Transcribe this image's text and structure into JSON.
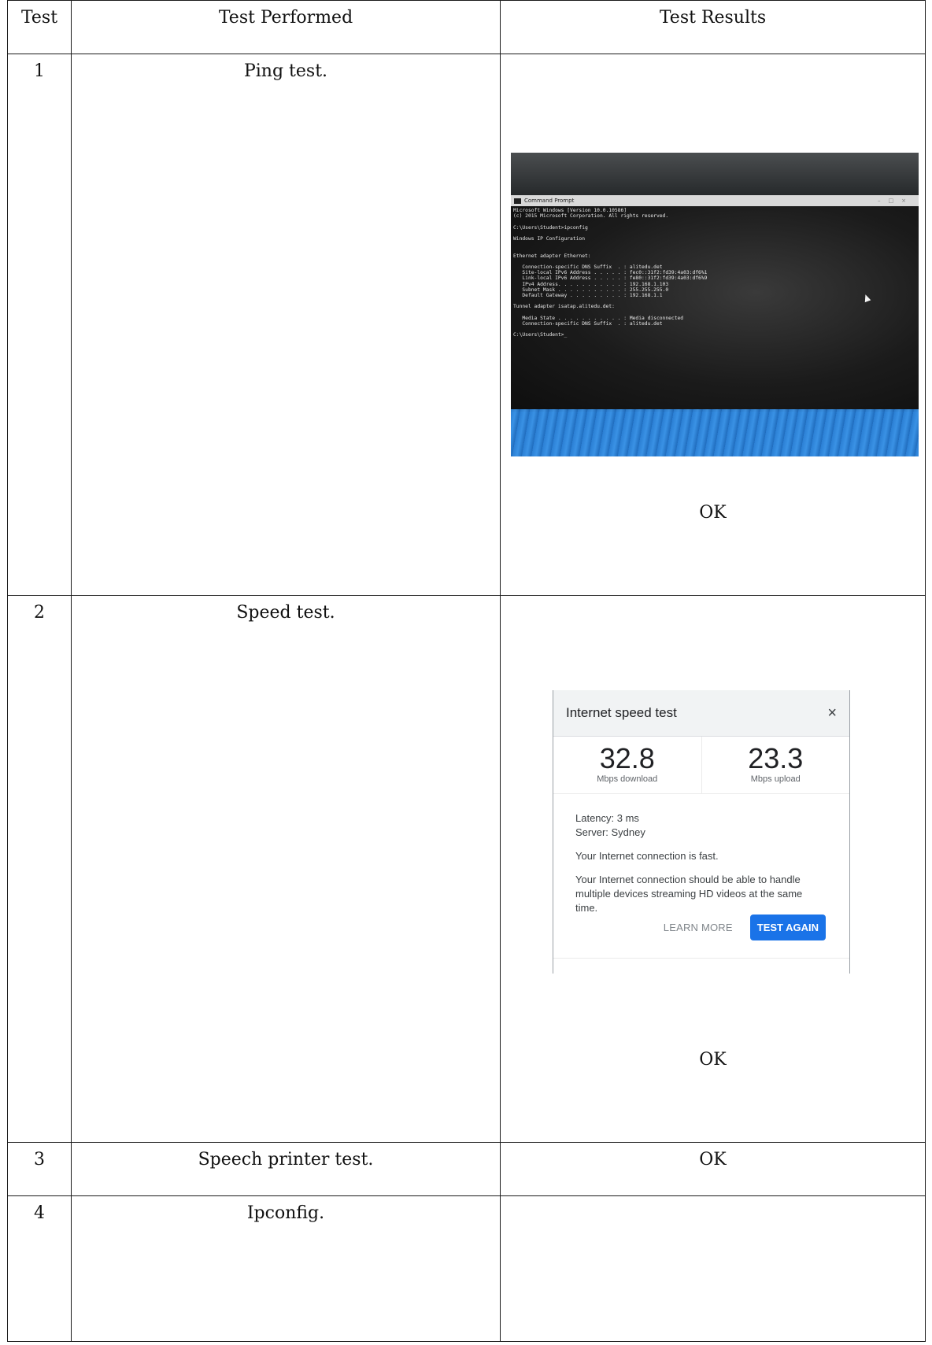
{
  "table": {
    "headers": [
      "Test",
      "Test Performed",
      "Test Results"
    ],
    "rows": [
      {
        "test": "1",
        "performed": "Ping test.",
        "result": "OK"
      },
      {
        "test": "2",
        "performed": "Speed test.",
        "result": "OK"
      },
      {
        "test": "3",
        "performed": "Speech printer test.",
        "result": "OK"
      },
      {
        "test": "4",
        "performed": "Ipconfig.",
        "result": ""
      }
    ]
  },
  "cmd_screenshot": {
    "window_title": "Command Prompt",
    "lines": [
      "Microsoft Windows [Version 10.0.10586]",
      "(c) 2015 Microsoft Corporation. All rights reserved.",
      "",
      "C:\\Users\\Student>ipconfig",
      "",
      "Windows IP Configuration",
      "",
      "",
      "Ethernet adapter Ethernet:",
      "",
      "   Connection-specific DNS Suffix  . : alitedu.det",
      "   Site-local IPv6 Address . . . . . : fec0::31f2:fd39:4a03:df6%1",
      "   Link-local IPv6 Address . . . . . : fe80::31f2:fd39:4a03:df6%9",
      "   IPv4 Address. . . . . . . . . . . : 192.168.1.103",
      "   Subnet Mask . . . . . . . . . . . : 255.255.255.0",
      "   Default Gateway . . . . . . . . . : 192.168.1.1",
      "",
      "Tunnel adapter isatap.alitedu.det:",
      "",
      "   Media State . . . . . . . . . . . : Media disconnected",
      "   Connection-specific DNS Suffix  . : alitedu.det",
      "",
      "C:\\Users\\Student>_"
    ]
  },
  "speed_test": {
    "title": "Internet speed test",
    "close_icon": "×",
    "download_value": "32.8",
    "download_label": "Mbps download",
    "upload_value": "23.3",
    "upload_label": "Mbps upload",
    "latency": "Latency: 3 ms",
    "server": "Server: Sydney",
    "verdict": "Your Internet connection is fast.",
    "description": "Your Internet connection should be able to handle multiple devices streaming HD videos at the same time.",
    "learn_more": "LEARN MORE",
    "test_again": "TEST AGAIN",
    "accent_color": "#1a73e8"
  }
}
